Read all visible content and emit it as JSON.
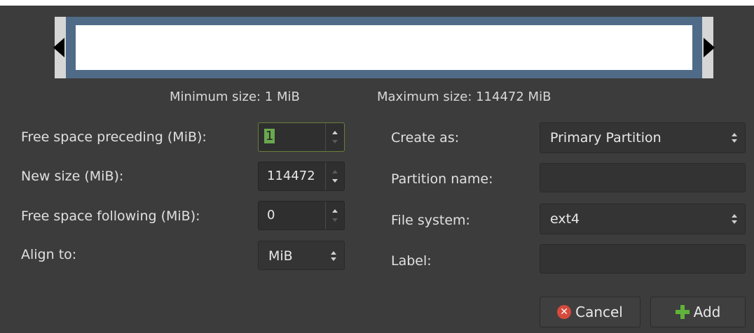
{
  "size_info": {
    "minimum": "Minimum size: 1 MiB",
    "maximum": "Maximum size: 114472 MiB"
  },
  "left_form": {
    "free_preceding": {
      "label": "Free space preceding (MiB):",
      "value": "1"
    },
    "new_size": {
      "label": "New size (MiB):",
      "value": "114472"
    },
    "free_following": {
      "label": "Free space following (MiB):",
      "value": "0"
    },
    "align_to": {
      "label": "Align to:",
      "value": "MiB"
    }
  },
  "right_form": {
    "create_as": {
      "label": "Create as:",
      "value": "Primary Partition"
    },
    "partition_name": {
      "label": "Partition name:",
      "value": ""
    },
    "file_system": {
      "label": "File system:",
      "value": "ext4"
    },
    "label": {
      "label": "Label:",
      "value": ""
    }
  },
  "buttons": {
    "cancel": "Cancel",
    "add": "Add"
  },
  "icons": {
    "cancel": "cancel-icon",
    "add": "add-icon",
    "resize_left": "resize-left-handle-icon",
    "resize_right": "resize-right-handle-icon"
  },
  "colors": {
    "background": "#3c3c3c",
    "partition_frame": "#4f6b87",
    "selection": "#6aa84f"
  }
}
